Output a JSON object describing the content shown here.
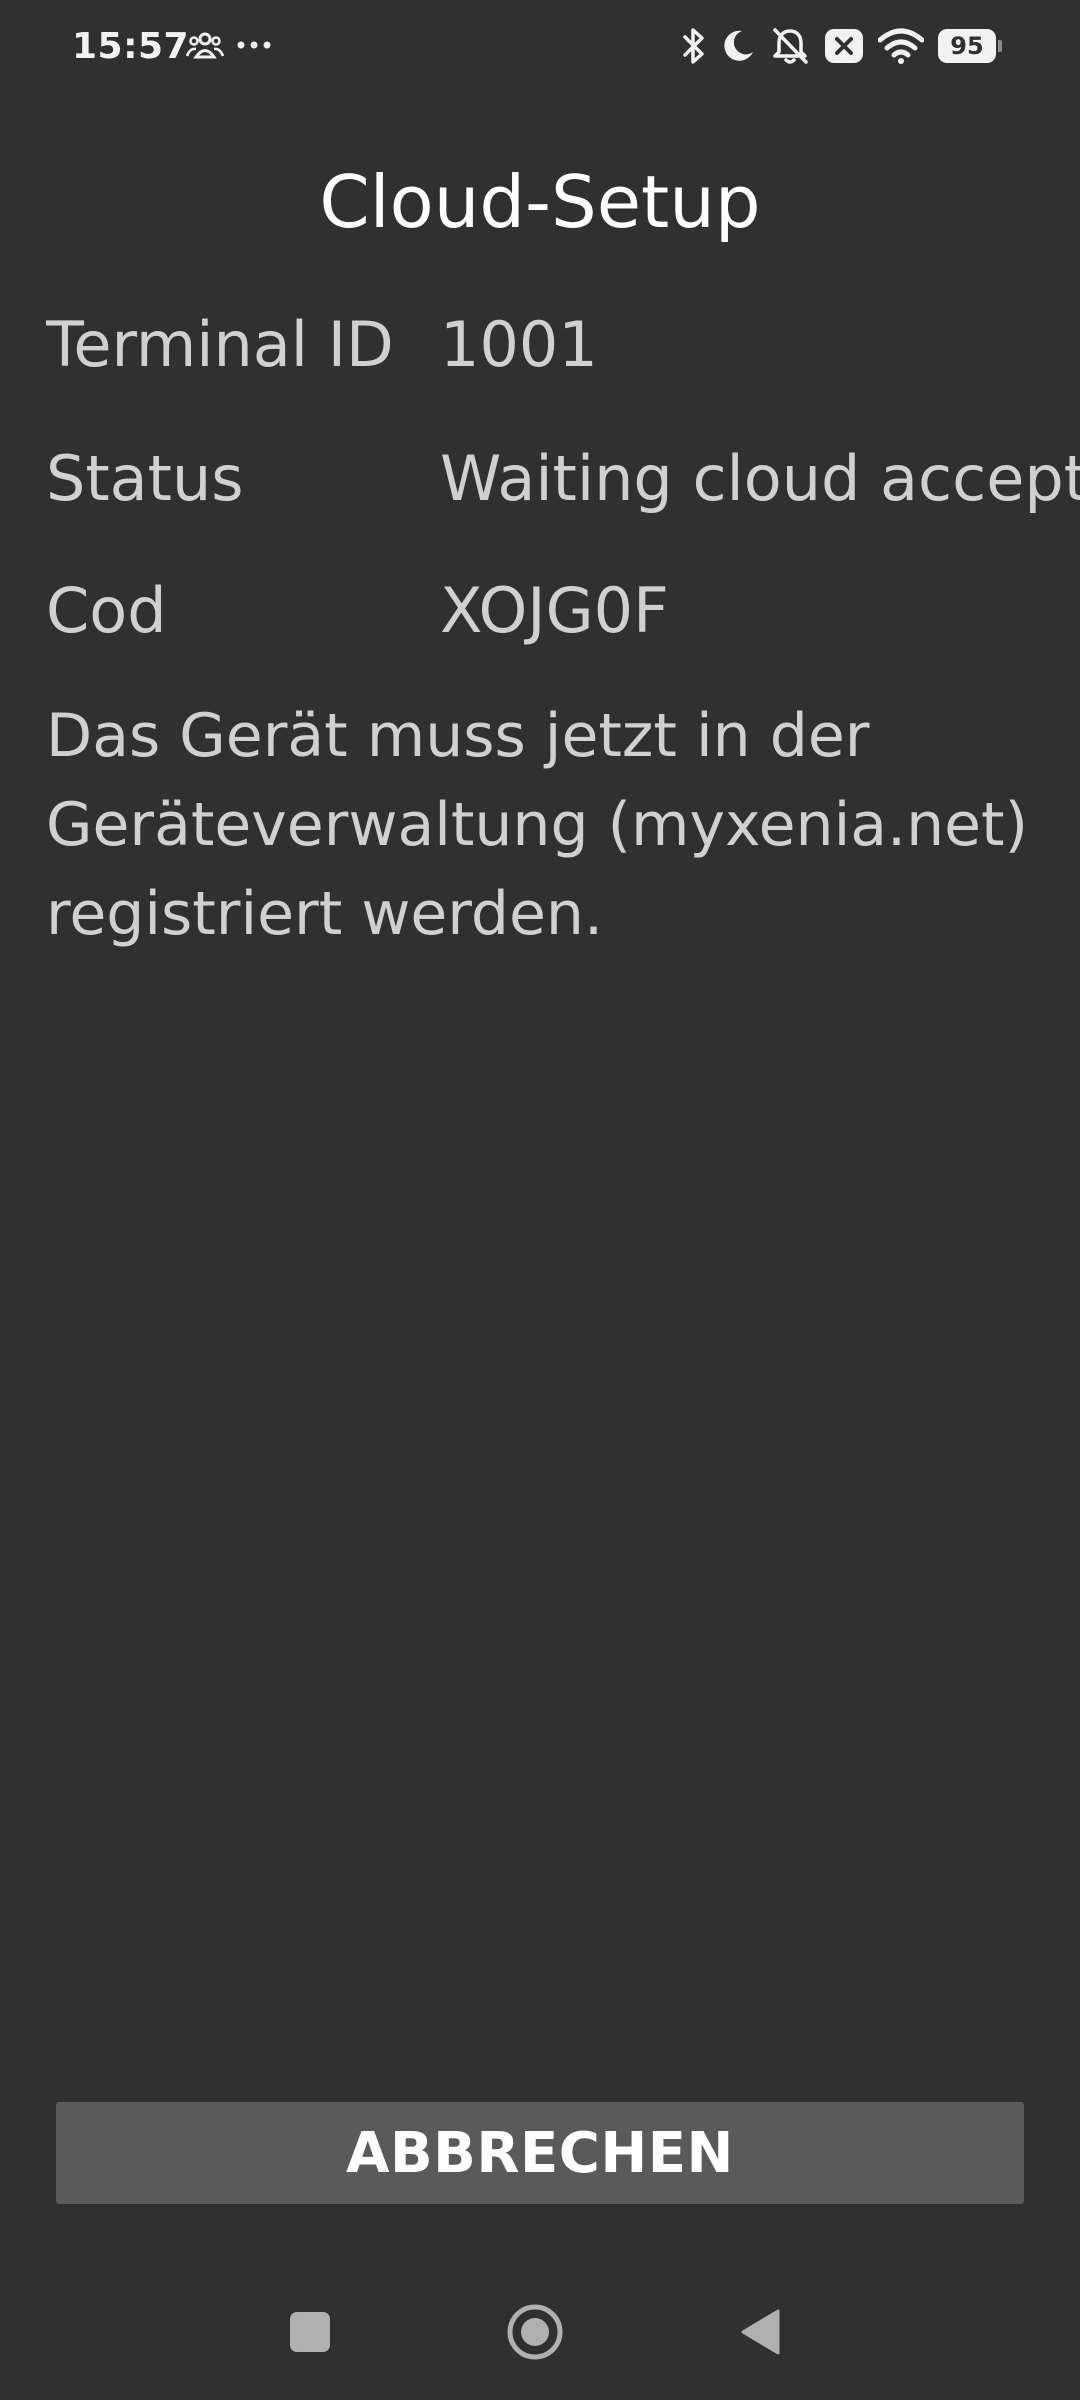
{
  "status_bar": {
    "time": "15:57",
    "battery_level": "95",
    "icons_left": [
      "people-icon",
      "more-dots-icon"
    ],
    "icons_right": [
      "bluetooth-icon",
      "moon-icon",
      "bell-off-icon",
      "close-box-icon",
      "wifi-icon",
      "battery-icon"
    ]
  },
  "screen": {
    "title": "Cloud-Setup"
  },
  "info": {
    "terminal_label": "Terminal ID",
    "terminal_value": "1001",
    "status_label": "Status",
    "status_value": "Waiting cloud accept",
    "cod_label": "Cod",
    "cod_value": "XOJG0F"
  },
  "message": "Das Gerät muss jetzt in der Geräteverwaltung (myxenia.net) registriert werden.",
  "actions": {
    "cancel_label": "ABBRECHEN"
  },
  "nav_bar": {
    "icons": [
      "recents-square-icon",
      "home-circle-icon",
      "back-triangle-icon"
    ]
  },
  "colors": {
    "background": "#303030",
    "button": "#5a5a5a",
    "text_primary": "#ffffff",
    "text_secondary": "#d0d0d0"
  }
}
